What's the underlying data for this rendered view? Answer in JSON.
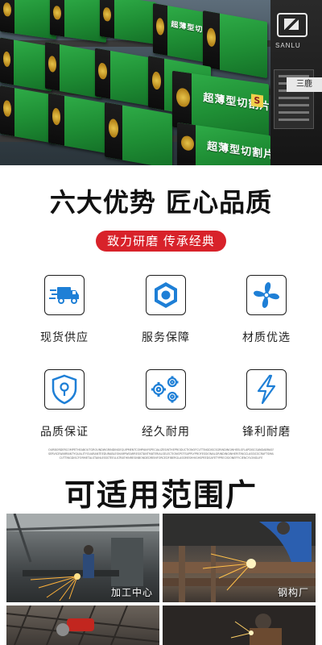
{
  "hero": {
    "box_label": "超薄型切割片",
    "box_mark": "S",
    "sign_brand": "SANLU",
    "sign_tag": "三鹿"
  },
  "advantages": {
    "title": "六大优势 匠心品质",
    "subtitle": "致力研磨 传承经典",
    "items": [
      {
        "label": "现货供应",
        "icon": "truck-icon"
      },
      {
        "label": "服务保障",
        "icon": "hex-nut-icon"
      },
      {
        "label": "材质优选",
        "icon": "fan-icon"
      },
      {
        "label": "品质保证",
        "icon": "shield-icon"
      },
      {
        "label": "经久耐用",
        "icon": "gears-icon"
      },
      {
        "label": "锋利耐磨",
        "icon": "lightning-icon"
      }
    ],
    "fine_print_1": "OURBORDERCOMPETHEABOUTGROUNDWGRINDINGEQUIPMENTCOMPANYSPECIALIZESINTHEPRODUCTIONOFCUTTINGDISCSGRINDINGWHEELSFLAPDISCSANDABRASIVEPRODUCTSQUALITYFIRSTCUSTOMERFIRST",
    "fine_print_2": "SERVICEWARRANTYQUALITYGUARANTEEDURABLESHARPWEARRESISTANTMATERIALSELECTIONSPOTSUPPLYPROFESSIONALGRINDINGINHERITINGCLASSICSCRAFTSMANSHIPQUALITYSIXADVANTAGES",
    "fine_print_3": "CUTTINGDISCFORMETALSTAINLESSSTEELULTRATHINRESINBONDEDREINFORCEDFIBERGLASSMESHHIGHSPEEDSAFETYPRECISIONEFFICIENCYLONGLIFE"
  },
  "applications": {
    "title": "可适用范围广",
    "photos": [
      {
        "caption": "加工中心"
      },
      {
        "caption": "钢构厂"
      },
      {
        "caption": ""
      },
      {
        "caption": ""
      }
    ]
  },
  "colors": {
    "accent_red": "#d8222a",
    "icon_blue": "#1e7fd6",
    "box_green": "#1f8f35"
  }
}
